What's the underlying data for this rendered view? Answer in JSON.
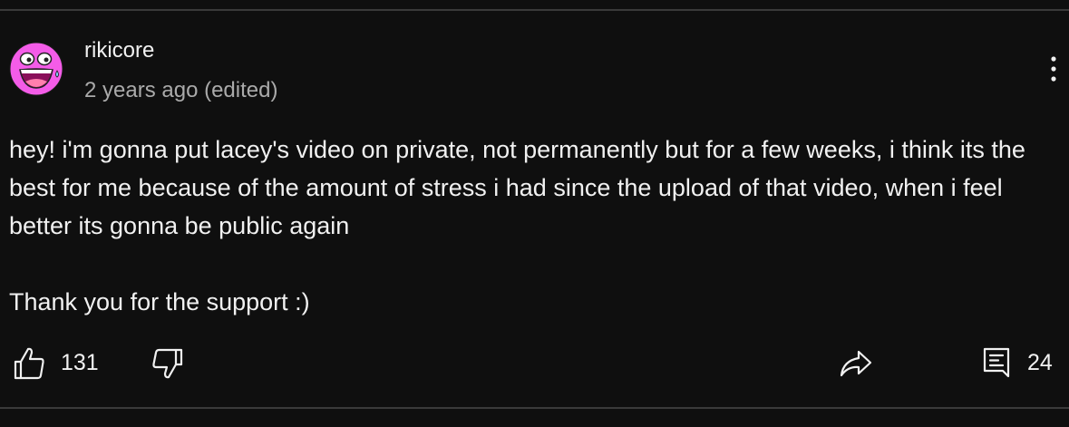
{
  "comment": {
    "author": "rikicore",
    "timestamp": "2 years ago (edited)",
    "paragraphs": [
      "hey! i'm gonna put lacey's video on private, not permanently but for a few weeks, i think its the best for me because of the amount of stress i had since the upload of that video, when i feel better its gonna be public again",
      "Thank you for the support :)"
    ],
    "like_count": "131",
    "reply_count": "24"
  },
  "colors": {
    "background": "#0f0f0f",
    "text_primary": "#f1f1f1",
    "text_secondary": "#aaaaaa",
    "divider": "#3a3a3a",
    "avatar_pink": "#f45ce8"
  },
  "icons": {
    "avatar": "awesome-face-avatar",
    "more": "vertical-ellipsis-icon",
    "like": "thumbs-up-icon",
    "dislike": "thumbs-down-icon",
    "share": "share-arrow-icon",
    "replies": "comment-replies-icon"
  }
}
